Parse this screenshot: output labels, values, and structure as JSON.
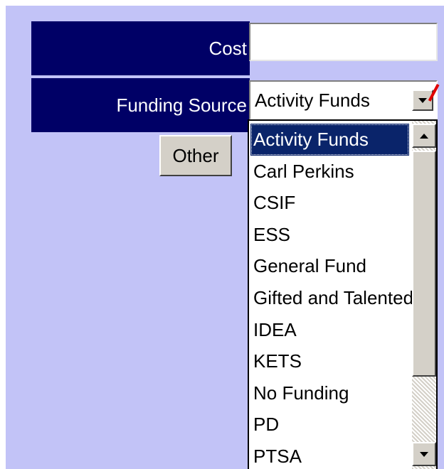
{
  "form": {
    "cost_label": "Cost",
    "cost_value": "",
    "funding_label": "Funding Source",
    "funding_selected": "Activity Funds",
    "other_button": "Other"
  },
  "dropdown": {
    "options": [
      "Activity Funds",
      "Carl Perkins",
      "CSIF",
      "ESS",
      "General Fund",
      "Gifted and Talented",
      "IDEA",
      "KETS",
      "No Funding",
      "PD",
      "PTSA"
    ],
    "highlighted_index": 0
  },
  "colors": {
    "page_background": "#c2c3f7",
    "label_background": "#000066",
    "selection_highlight": "#0a246a",
    "pointer": "#e00000"
  },
  "icons": {
    "select_arrow": "chevron-down-icon",
    "scroll_up": "scroll-up-icon",
    "scroll_down": "scroll-down-icon"
  }
}
